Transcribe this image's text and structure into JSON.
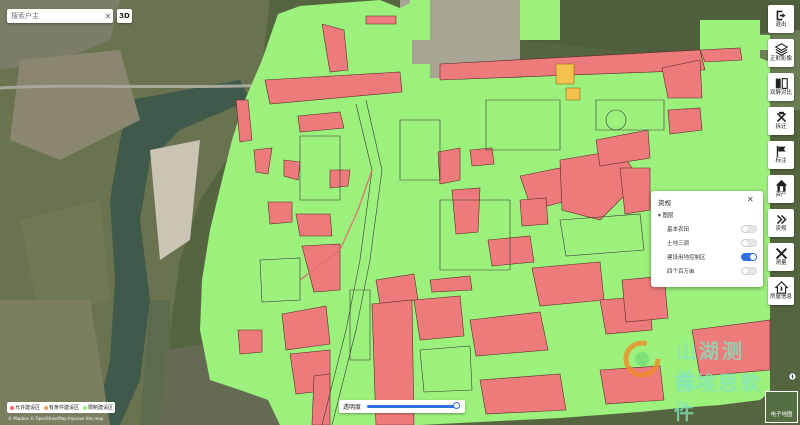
{
  "search": {
    "placeholder": "搜索户主",
    "clear_icon": "close-icon"
  },
  "view_3d_label": "3D",
  "toolbar": [
    {
      "icon": "logout-icon",
      "label": "退出"
    },
    {
      "icon": "layers-icon",
      "label": "正射影像"
    },
    {
      "icon": "split-screen-icon",
      "label": "双屏对比"
    },
    {
      "icon": "demolition-icon",
      "label": "拆迁"
    },
    {
      "icon": "flag-icon",
      "label": "标注"
    },
    {
      "icon": "house-icon",
      "label": "资产"
    },
    {
      "icon": "chevrons-right-icon",
      "label": "资规"
    },
    {
      "icon": "ruler-cross-icon",
      "label": "测量"
    },
    {
      "icon": "house-info-icon",
      "label": "房屋信息"
    }
  ],
  "layer_panel": {
    "title": "资规",
    "group": "图层",
    "layers": [
      {
        "label": "基本农田",
        "on": false
      },
      {
        "label": "土地三调",
        "on": false
      },
      {
        "label": "建设用地控制区",
        "on": true
      },
      {
        "label": "四个百万亩",
        "on": false
      }
    ]
  },
  "legend": [
    {
      "label": "允许建设区",
      "color": "#ee6a6a"
    },
    {
      "label": "有条件建设区",
      "color": "#f0a050"
    },
    {
      "label": "限制建设区",
      "color": "#9cf07c"
    }
  ],
  "attribution": "© Mapbox © OpenStreetMap Improve this map",
  "opacity": {
    "label": "透明度",
    "value": 1.0
  },
  "watermark": {
    "line1": "山湖测绘",
    "line2": "吉埃思软件"
  },
  "map_switch_label": "电子地图",
  "colors": {
    "allowed": "#ee7b7b",
    "restricted": "#9cf07c",
    "conditional": "#f3c14c",
    "accent": "#2f6fe0"
  }
}
